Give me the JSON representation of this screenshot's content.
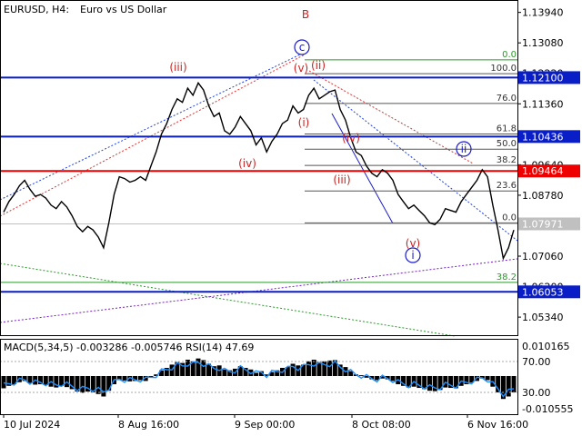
{
  "header": {
    "symbol": "EURUSD, H4:",
    "description": "Euro vs US Dollar"
  },
  "chart_data": {
    "type": "line",
    "main": {
      "price_ticks": [
        1.1394,
        1.1308,
        1.1222,
        1.1136,
        1.105,
        1.0964,
        1.0878,
        1.0792,
        1.0706,
        1.062,
        1.0534
      ],
      "ylim": [
        1.0483,
        1.1429
      ],
      "price_line_labels": [
        {
          "value": 1.121,
          "text": "1.12100",
          "color": "#0a1ec8"
        },
        {
          "value": 1.10436,
          "text": "1.10436",
          "color": "#0a1ec8"
        },
        {
          "value": 1.09464,
          "text": "1.09464",
          "color": "#ee0000"
        },
        {
          "value": 1.07971,
          "text": "1.07971",
          "color": "#c0c0c0"
        },
        {
          "value": 1.06053,
          "text": "1.06053",
          "color": "#0a1ec8"
        }
      ],
      "fib_levels": [
        {
          "text": "0.0",
          "value": 1.126
        },
        {
          "text": "100.0",
          "value": 1.1221
        },
        {
          "text": "76.0",
          "value": 1.1137
        },
        {
          "text": "61.8",
          "value": 1.1051
        },
        {
          "text": "50.0",
          "value": 1.1008
        },
        {
          "text": "38.2",
          "value": 1.0962
        },
        {
          "text": "23.6",
          "value": 1.089
        },
        {
          "text": "0.0",
          "value": 1.08
        },
        {
          "text": "38.2",
          "value": 1.0632
        }
      ],
      "wave_labels": [
        {
          "text": "B",
          "color": "#cc2222"
        },
        {
          "text": "c",
          "color": "#1a1acc"
        },
        {
          "text": "(iii)",
          "color": "#cc2222"
        },
        {
          "text": "(v)",
          "color": "#cc2222"
        },
        {
          "text": "(ii)",
          "color": "#cc2222"
        },
        {
          "text": "(iv)",
          "color": "#cc2222"
        },
        {
          "text": "(i)",
          "color": "#cc2222"
        },
        {
          "text": "(iv)",
          "color": "#cc2222"
        },
        {
          "text": "(iii)",
          "color": "#cc2222"
        },
        {
          "text": "ii",
          "color": "#1a1acc"
        },
        {
          "text": "(v)",
          "color": "#cc2222"
        },
        {
          "text": "i",
          "color": "#1a1acc"
        }
      ],
      "close": [
        1.083,
        1.086,
        1.088,
        1.0905,
        1.092,
        1.0895,
        1.0875,
        1.088,
        1.087,
        1.085,
        1.084,
        1.086,
        1.0845,
        1.082,
        1.079,
        1.0775,
        1.079,
        1.078,
        1.076,
        1.073,
        1.08,
        1.088,
        1.093,
        1.0925,
        1.0915,
        1.092,
        1.093,
        1.092,
        1.096,
        1.1,
        1.105,
        1.108,
        1.112,
        1.115,
        1.114,
        1.118,
        1.116,
        1.1195,
        1.1175,
        1.113,
        1.11,
        1.111,
        1.106,
        1.105,
        1.107,
        1.11,
        1.108,
        1.106,
        1.102,
        1.104,
        1.1,
        1.103,
        1.105,
        1.108,
        1.109,
        1.113,
        1.111,
        1.112,
        1.116,
        1.118,
        1.115,
        1.116,
        1.117,
        1.1175,
        1.112,
        1.109,
        1.104,
        1.1,
        1.099,
        1.096,
        1.094,
        1.093,
        1.095,
        1.094,
        1.092,
        1.088,
        1.086,
        1.084,
        1.085,
        1.0835,
        1.082,
        1.08,
        1.0795,
        1.081,
        1.084,
        1.0835,
        1.083,
        1.086,
        1.088,
        1.09,
        1.092,
        1.095,
        1.093,
        1.085,
        1.078,
        1.07,
        1.073,
        1.078
      ]
    },
    "macd_panel": {
      "label": "MACD(5,34,5) -0.003286 -0.005746 RSI(14) 47.69",
      "ticks": [
        {
          "text": "0.010165"
        },
        {
          "text": "70.00"
        },
        {
          "text": "30.00"
        },
        {
          "text": "-0.010555"
        }
      ]
    },
    "x_ticks": [
      "10 Jul 2024",
      "8 Aug 16:00",
      "9 Sep 00:00",
      "8 Oct 08:00",
      "6 Nov 16:00"
    ],
    "grid": false
  }
}
